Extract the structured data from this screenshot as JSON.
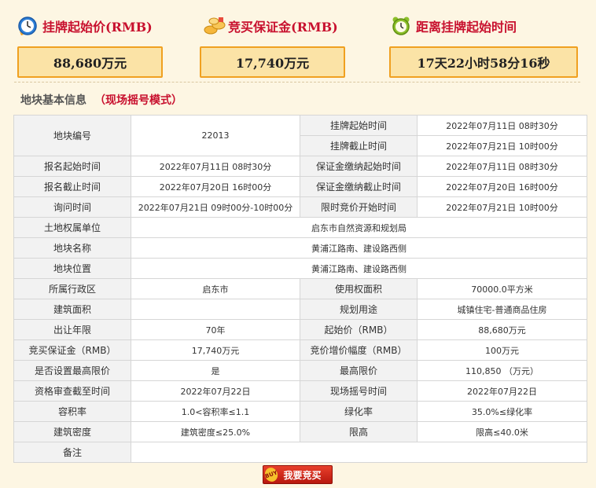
{
  "stats": [
    {
      "icon": "clock-icon",
      "title": "挂牌起始价(RMB)",
      "value": "88,680万元"
    },
    {
      "icon": "coins-icon",
      "title": "竞买保证金(RMB)",
      "value": "17,740万元"
    },
    {
      "icon": "alarm-clock-icon",
      "title": "距离挂牌起始时间",
      "value": "17天22小时58分16秒"
    }
  ],
  "section": {
    "title": "地块基本信息",
    "mode": "（现场摇号模式）"
  },
  "table": {
    "parcel_no": {
      "label": "地块编号",
      "value": "22013"
    },
    "listing_start": {
      "label": "挂牌起始时间",
      "value": "2022年07月11日 08时30分"
    },
    "listing_end": {
      "label": "挂牌截止时间",
      "value": "2022年07月21日 10时00分"
    },
    "signup_start": {
      "label": "报名起始时间",
      "value": "2022年07月11日 08时30分"
    },
    "deposit_start": {
      "label": "保证金缴纳起始时间",
      "value": "2022年07月11日 08时30分"
    },
    "signup_end": {
      "label": "报名截止时间",
      "value": "2022年07月20日 16时00分"
    },
    "deposit_end": {
      "label": "保证金缴纳截止时间",
      "value": "2022年07月20日 16时00分"
    },
    "inquiry_time": {
      "label": "询问时间",
      "value": "2022年07月21日 09时00分-10时00分"
    },
    "timed_bid_start": {
      "label": "限时竞价开始时间",
      "value": "2022年07月21日 10时00分"
    },
    "owner": {
      "label": "土地权属单位",
      "value": "启东市自然资源和规划局"
    },
    "name": {
      "label": "地块名称",
      "value": "黄浦江路南、建设路西侧"
    },
    "location": {
      "label": "地块位置",
      "value": "黄浦江路南、建设路西侧"
    },
    "district": {
      "label": "所属行政区",
      "value": "启东市"
    },
    "use_area": {
      "label": "使用权面积",
      "value": "70000.0平方米"
    },
    "build_area": {
      "label": "建筑面积",
      "value": ""
    },
    "planned_use": {
      "label": "规划用途",
      "value": "城镇住宅-普通商品住房"
    },
    "term": {
      "label": "出让年限",
      "value": "70年"
    },
    "start_price": {
      "label": "起始价（RMB）",
      "value": "88,680万元"
    },
    "deposit": {
      "label": "竞买保证金（RMB）",
      "value": "17,740万元"
    },
    "increment": {
      "label": "竞价增价幅度（RMB）",
      "value": "100万元"
    },
    "has_cap": {
      "label": "是否设置最高限价",
      "value": "是"
    },
    "cap_price": {
      "label": "最高限价",
      "value": "110,850 （万元）"
    },
    "review_deadline": {
      "label": "资格审查截至时间",
      "value": "2022年07月22日"
    },
    "lottery_time": {
      "label": "现场摇号时间",
      "value": "2022年07月22日"
    },
    "far": {
      "label": "容积率",
      "value": "1.0<容积率≤1.1"
    },
    "green": {
      "label": "绿化率",
      "value": "35.0%≤绿化率"
    },
    "density": {
      "label": "建筑密度",
      "value": "建筑密度≤25.0%"
    },
    "height": {
      "label": "限高",
      "value": "限高≤40.0米"
    },
    "remarks": {
      "label": "备注",
      "value": ""
    }
  },
  "buy_button": {
    "tag": "BUY",
    "label": "我要竞买"
  }
}
